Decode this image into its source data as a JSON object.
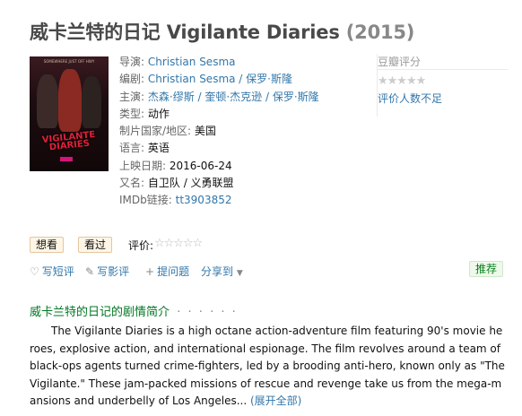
{
  "title": {
    "main": "威卡兰特的日记 Vigilante Diaries",
    "year": "(2015)"
  },
  "poster": {
    "tagline": "SOMEWHERE JUST OFF HWY",
    "title_line1": "VIGILANTE",
    "title_line2": "DIARIES"
  },
  "info": [
    {
      "label": "导演:",
      "value": "Christian Sesma",
      "linked": true
    },
    {
      "label": "编剧:",
      "value": "Christian Sesma / 保罗·斯隆",
      "linked": true
    },
    {
      "label": "主演:",
      "value": "杰森·缪斯 / 奎顿·杰克逊 / 保罗·斯隆",
      "linked": true
    },
    {
      "label": "类型:",
      "value": "动作",
      "linked": false
    },
    {
      "label": "制片国家/地区:",
      "value": "美国",
      "linked": false
    },
    {
      "label": "语言:",
      "value": "英语",
      "linked": false
    },
    {
      "label": "上映日期:",
      "value": "2016-06-24",
      "linked": false
    },
    {
      "label": "又名:",
      "value": "自卫队 / 义勇联盟",
      "linked": false
    },
    {
      "label": "IMDb链接:",
      "value": "tt3903852",
      "linked": true
    }
  ],
  "rating": {
    "head": "豆瓣评分",
    "stars": "★★★★★",
    "few": "评价人数不足"
  },
  "buttons": {
    "want": "想看",
    "seen": "看过"
  },
  "rate": {
    "label": "评价:",
    "stars": "☆☆☆☆☆"
  },
  "actions": {
    "short_review": "写短评",
    "review": "写影评",
    "question": "提问题",
    "share": "分享到"
  },
  "recommend": "推荐",
  "synopsis": {
    "title": "威卡兰特的日记的剧情简介",
    "dots": "· · · · · ·",
    "text": "The Vigilante Diaries is a high octane action-adventure film featuring 90's movie heroes, explosive action, and international espionage. The film revolves around a team of black-ops agents turned crime-fighters, led by a brooding anti-hero, known only as \"The Vigilante.\" These jam-packed missions of rescue and revenge take us from the mega-mansions and underbelly of Los Angeles...",
    "expand": "(展开全部)"
  },
  "colors": {
    "link": "#3377aa",
    "title": "#494949",
    "section": "#007722",
    "recommend_bg": "#eef9eb"
  }
}
